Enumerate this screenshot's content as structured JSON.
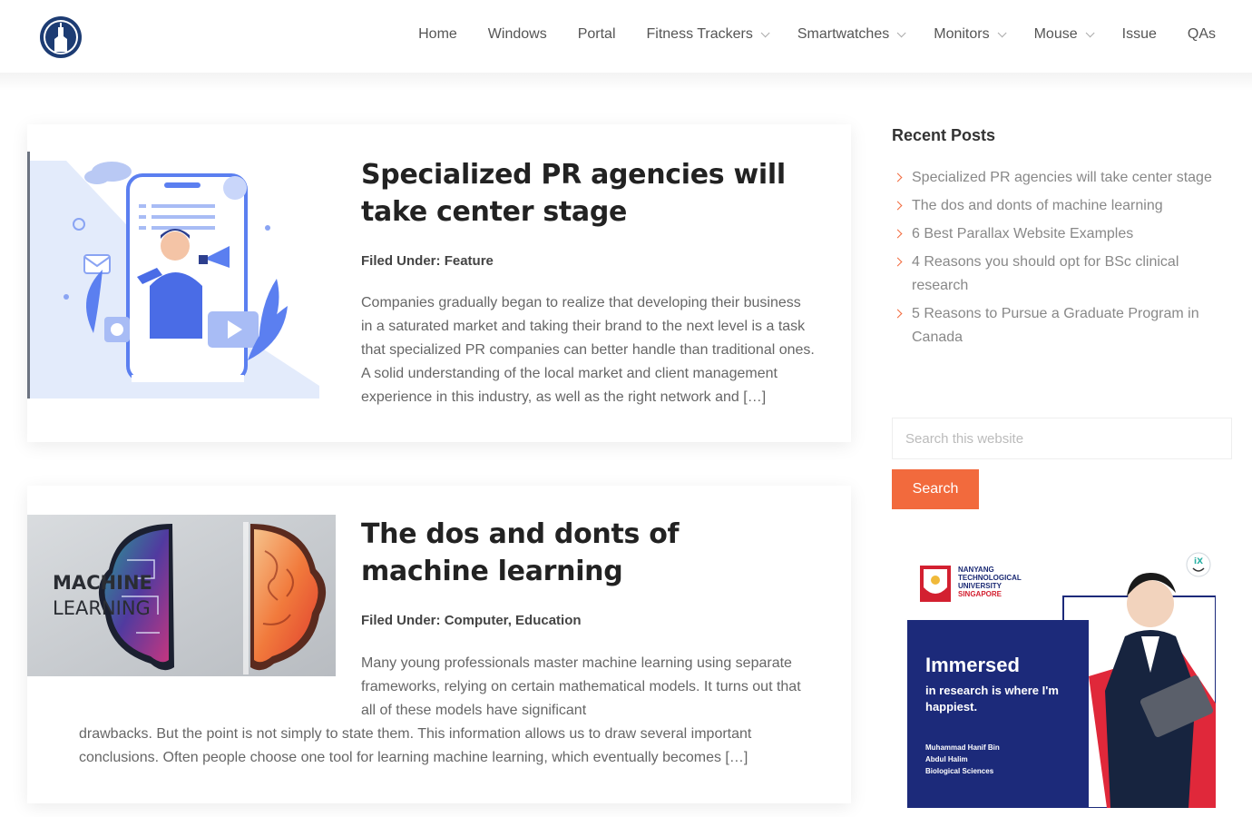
{
  "header": {
    "nav": [
      {
        "label": "Home",
        "dropdown": false
      },
      {
        "label": "Windows",
        "dropdown": false
      },
      {
        "label": "Portal",
        "dropdown": false
      },
      {
        "label": "Fitness Trackers",
        "dropdown": true
      },
      {
        "label": "Smartwatches",
        "dropdown": true
      },
      {
        "label": "Monitors",
        "dropdown": true
      },
      {
        "label": "Mouse",
        "dropdown": true
      },
      {
        "label": "Issue",
        "dropdown": false
      },
      {
        "label": "QAs",
        "dropdown": false
      }
    ]
  },
  "posts": [
    {
      "title": "Specialized PR agencies will take center stage",
      "filed_label": "Filed Under:",
      "categories": "Feature",
      "excerpt": "Companies gradually began to realize that developing their business in a saturated market and taking their brand to the next level is a task that specialized PR companies can better handle than traditional ones. A solid understanding of the local market and client management experience in this industry, as well as the right network and […]"
    },
    {
      "title": "The dos and donts of machine learning",
      "filed_label": "Filed Under:",
      "categories": "Computer, Education",
      "thumb_text_1": "MACHINE",
      "thumb_text_2": "LEARNING",
      "excerpt_part1": "Many young professionals master machine learning using separate frameworks, relying on certain mathematical models. It turns out that all of these models have significant",
      "excerpt_part2": "drawbacks. But the point is not simply to state them. This information allows us to draw several important conclusions. Often people choose one tool for learning machine learning, which eventually becomes […]"
    }
  ],
  "sidebar": {
    "recent_title": "Recent Posts",
    "recent_posts": [
      "Specialized PR agencies will take center stage",
      "The dos and donts of machine learning",
      "6 Best Parallax Website Examples",
      "4 Reasons you should opt for BSc clinical research",
      "5 Reasons to Pursue a Graduate Program in Canada"
    ],
    "search_placeholder": "Search this website",
    "search_button": "Search"
  },
  "ad": {
    "logo_lines": [
      "NANYANG",
      "TECHNOLOGICAL",
      "UNIVERSITY"
    ],
    "logo_country": "SINGAPORE",
    "headline": "Immersed",
    "subline": "in research is where I'm happiest.",
    "person_lines": [
      "Muhammad Hanif Bin",
      "Abdul Halim",
      "Biological Sciences"
    ],
    "badge": "iX"
  },
  "colors": {
    "accent": "#f26a3d",
    "ad_navy": "#1c2a7a",
    "ad_red": "#d32030",
    "illustration_blue": "#5b7ff0"
  }
}
